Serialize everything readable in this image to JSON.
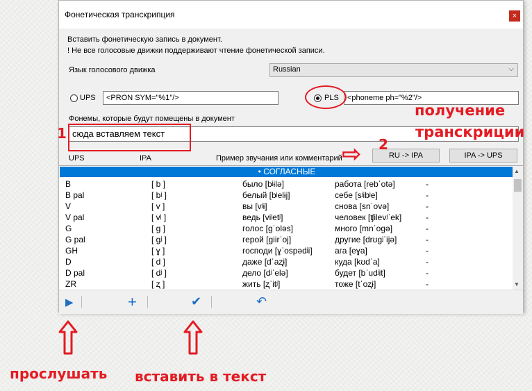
{
  "window": {
    "title": "Фонетическая транскрипция",
    "close_glyph": "×"
  },
  "intro": {
    "line1": "Вставить фонетическую запись в документ.",
    "line2": "! Не все голосовые движки поддерживают чтение фонетической записи."
  },
  "engine": {
    "label": "Язык голосового движка",
    "selected": "Russian",
    "chevron": "⌵"
  },
  "ups": {
    "label": "UPS",
    "template": "<PRON SYM=\"%1\"/>"
  },
  "pls": {
    "label": "PLS",
    "template": "<phoneme ph=\"%2\"/>"
  },
  "phonemes": {
    "label": "Фонемы, которые будут помещены в документ",
    "value": "сюда вставляем текст"
  },
  "columns": {
    "ups": "UPS",
    "ipa": "IPA",
    "example": "Пример звучания или комментарий"
  },
  "buttons": {
    "ru_ipa": "RU -> IPA",
    "ipa_ups": "IPA -> UPS"
  },
  "list": {
    "section": "• СОГЛАСНЫЕ",
    "rows": [
      {
        "ups": "B",
        "ipa": "[ b ]",
        "ex1": "было [bʲɨlə]",
        "ex2": "работа [rebˈotə]",
        "note": "-"
      },
      {
        "ups": "B pal",
        "ipa": "[ bʲ ]",
        "ex1": "белый [bʲelɨj]",
        "ex2": "себе [sʲibʲe]",
        "note": "-"
      },
      {
        "ups": "V",
        "ipa": "[ v ]",
        "ex1": "вы [vʲɨ]",
        "ex2": "снова [snˈovə]",
        "note": "-"
      },
      {
        "ups": "V pal",
        "ipa": "[ vʲ ]",
        "ex1": "ведь [viʲetʲ]",
        "ex2": "человек [ʧilevʲˈek]",
        "note": "-"
      },
      {
        "ups": "G",
        "ipa": "[ g ]",
        "ex1": "голос [gˈoləs]",
        "ex2": "много [mnˈogə]",
        "note": "-"
      },
      {
        "ups": "G pal",
        "ipa": "[ gʲ ]",
        "ex1": "герой [giirˈoj]",
        "ex2": "другие [drʊgʲˈijə]",
        "note": "-"
      },
      {
        "ups": "GH",
        "ipa": "[ ɣ ]",
        "ex1": "господи [ɣˈospədʲi]",
        "ex2": "ага [eɣa]",
        "note": "-"
      },
      {
        "ups": "D",
        "ipa": "[ d ]",
        "ex1": "даже [dˈaʐɨ]",
        "ex2": "куда [kʊdˈa]",
        "note": "-"
      },
      {
        "ups": "D pal",
        "ipa": "[ dʲ ]",
        "ex1": "дело [dʲˈelə]",
        "ex2": "будет [bˈudʲit]",
        "note": "-"
      },
      {
        "ups": "ZR",
        "ipa": "[ ʐ ]",
        "ex1": "жить [ʐˈitʲ]",
        "ex2": "тоже [tˈoʐɨ]",
        "note": "-"
      }
    ],
    "scroll_up": "▲",
    "scroll_down": "▼"
  },
  "toolbar": {
    "play_glyph": "▶",
    "add_glyph": "+",
    "check_glyph": "✔",
    "undo_glyph": "↶"
  },
  "annotations": {
    "num1": "1",
    "num2": "2",
    "get_transcription_1": "получение",
    "get_transcription_2": "транскриции",
    "listen": "прослушать",
    "insert": "вставить в текст",
    "arrow_right": "⇨"
  },
  "colors": {
    "accent": "#0078d7",
    "annotation": "#e31b23",
    "icon": "#1e6fc4"
  }
}
